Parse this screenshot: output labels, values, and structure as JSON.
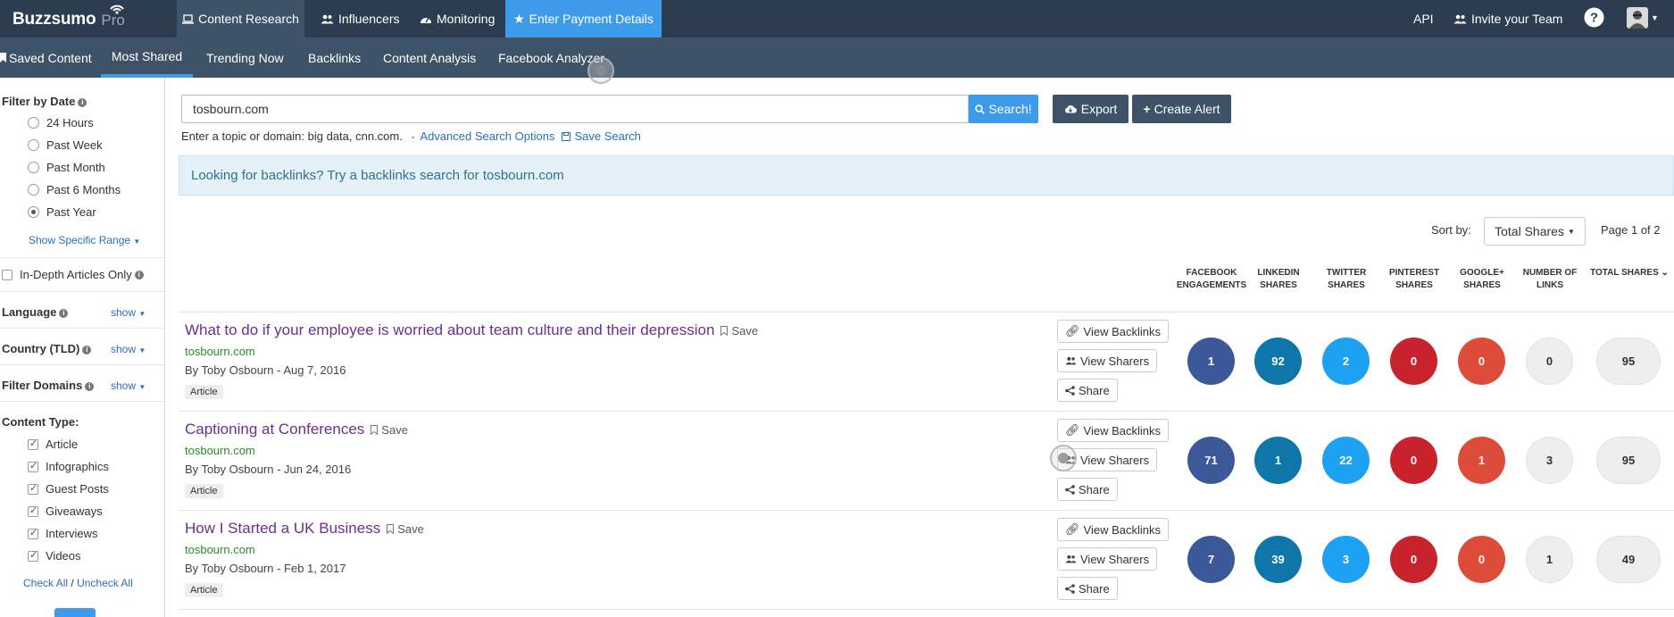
{
  "brand": {
    "name": "Buzzsumo",
    "tier": "Pro"
  },
  "topnav": {
    "items": [
      {
        "label": "Content Research",
        "icon": "laptop-icon"
      },
      {
        "label": "Influencers",
        "icon": "users-icon"
      },
      {
        "label": "Monitoring",
        "icon": "dashboard-icon"
      },
      {
        "label": "Enter Payment Details",
        "icon": "star-icon"
      }
    ],
    "api": "API",
    "invite": "Invite your Team",
    "help_icon": "help-icon",
    "avatar_icon": "avatar"
  },
  "subnav": {
    "items": [
      "Saved Content",
      "Most Shared",
      "Trending Now",
      "Backlinks",
      "Content Analysis",
      "Facebook Analyzer"
    ],
    "active": "Most Shared"
  },
  "sidebar": {
    "filter_by_date": "Filter by Date",
    "date_options": [
      "24 Hours",
      "Past Week",
      "Past Month",
      "Past 6 Months",
      "Past Year"
    ],
    "date_selected": "Past Year",
    "show_range": "Show Specific Range",
    "in_depth": "In-Depth Articles Only",
    "language": "Language",
    "country": "Country (TLD)",
    "filter_domains": "Filter Domains",
    "show": "show",
    "content_type": "Content Type:",
    "types": [
      "Article",
      "Infographics",
      "Guest Posts",
      "Giveaways",
      "Interviews",
      "Videos"
    ],
    "check_all": "Check All",
    "separator": "/",
    "uncheck_all": "Uncheck All"
  },
  "search": {
    "value": "tosbourn.com",
    "button": "Search!",
    "export": "Export",
    "create_alert": "Create Alert",
    "hint": "Enter a topic or domain: big data, cnn.com.",
    "advanced": "Advanced Search Options",
    "save_search": "Save Search"
  },
  "banner": "Looking for backlinks? Try a backlinks search for tosbourn.com",
  "sort": {
    "label": "Sort by:",
    "value": "Total Shares",
    "page": "Page 1 of 2"
  },
  "columns": [
    [
      "FACEBOOK",
      "ENGAGEMENTS"
    ],
    [
      "LINKEDIN",
      "SHARES"
    ],
    [
      "TWITTER",
      "SHARES"
    ],
    [
      "PINTEREST",
      "SHARES"
    ],
    [
      "GOOGLE+",
      "SHARES"
    ],
    [
      "NUMBER OF",
      "LINKS"
    ],
    [
      "TOTAL SHARES",
      ""
    ]
  ],
  "actions": {
    "backlinks": "View Backlinks",
    "sharers": "View Sharers",
    "share": "Share",
    "save": "Save"
  },
  "results": [
    {
      "title": "What to do if your employee is worried about team culture and their depression",
      "domain": "tosbourn.com",
      "byline": "By Toby Osbourn - Aug 7, 2016",
      "tag": "Article",
      "stats": {
        "facebook": "1",
        "linkedin": "92",
        "twitter": "2",
        "pinterest": "0",
        "googleplus": "0",
        "links": "0",
        "total": "95"
      }
    },
    {
      "title": "Captioning at Conferences",
      "domain": "tosbourn.com",
      "byline": "By Toby Osbourn - Jun 24, 2016",
      "tag": "Article",
      "stats": {
        "facebook": "71",
        "linkedin": "1",
        "twitter": "22",
        "pinterest": "0",
        "googleplus": "1",
        "links": "3",
        "total": "95"
      }
    },
    {
      "title": "How I Started a UK Business",
      "domain": "tosbourn.com",
      "byline": "By Toby Osbourn - Feb 1, 2017",
      "tag": "Article",
      "stats": {
        "facebook": "7",
        "linkedin": "39",
        "twitter": "3",
        "pinterest": "0",
        "googleplus": "0",
        "links": "1",
        "total": "49"
      }
    }
  ]
}
